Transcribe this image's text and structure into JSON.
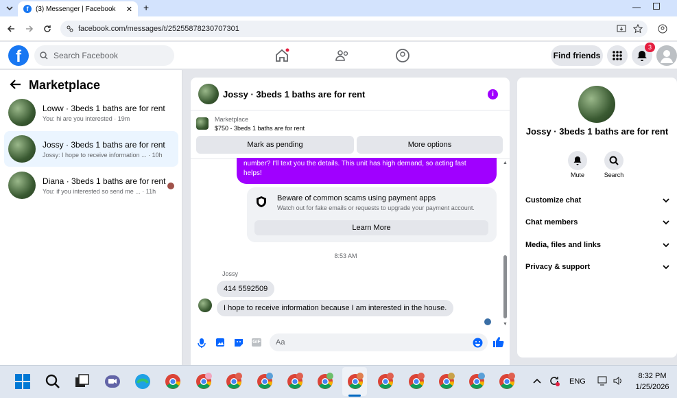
{
  "browser": {
    "tab_title": "(3) Messenger | Facebook",
    "url": "facebook.com/messages/t/25255878230707301"
  },
  "fb_header": {
    "search_placeholder": "Search Facebook",
    "find_friends": "Find friends",
    "notification_count": "3"
  },
  "left_panel": {
    "title": "Marketplace",
    "conversations": [
      {
        "name": "Loww · 3beds 1 baths are for rent",
        "preview": "You: hi are you interested · 19m"
      },
      {
        "name": "Jossy · 3beds 1 baths are for rent",
        "preview": "Jossy: I hope to receive information ... · 10h"
      },
      {
        "name": "Diana · 3beds 1 baths are for rent",
        "preview": "You: if you interested so send me ... · 11h"
      }
    ]
  },
  "chat": {
    "header_name": "Jossy · 3beds 1 baths are for rent",
    "marketplace_label": "Marketplace",
    "listing": "$750 - 3beds 1 baths are for rent",
    "mark_pending": "Mark as pending",
    "more_options": "More options",
    "purple_line1": "number? I'll text you the details. This unit has high demand, so acting fast",
    "purple_line2": "helps!",
    "scam_title": "Beware of common scams using payment apps",
    "scam_sub": "Watch out for fake emails or requests to upgrade your payment account.",
    "learn_more": "Learn More",
    "timestamp": "8:53 AM",
    "sender": "Jossy",
    "msg1": "414 5592509",
    "msg2": "I hope to receive information because I am interested in the house.",
    "composer_placeholder": "Aa"
  },
  "right_panel": {
    "name": "Jossy · 3beds 1 baths are for rent",
    "mute": "Mute",
    "search": "Search",
    "sections": [
      "Customize chat",
      "Chat members",
      "Media, files and links",
      "Privacy & support"
    ]
  },
  "taskbar": {
    "lang": "ENG",
    "time": "8:32 PM",
    "date": "1/25/2026"
  },
  "colors": {
    "fb_blue": "#1877f2",
    "messenger_purple": "#a000ff",
    "badge_red": "#e41e3f"
  }
}
